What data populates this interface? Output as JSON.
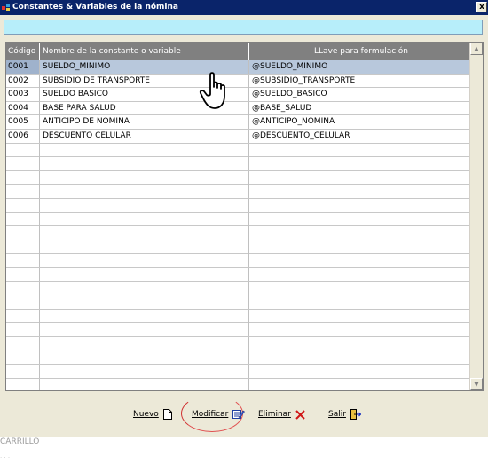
{
  "window": {
    "title": "Constantes & Variables de la nómina",
    "close_label": "x"
  },
  "search": {
    "value": "",
    "placeholder": ""
  },
  "grid": {
    "headers": [
      "Código",
      "Nombre de la constante o variable",
      "LLave para formulación"
    ],
    "rows": [
      [
        "0001",
        "SUELDO_MINIMO",
        "@SUELDO_MINIMO"
      ],
      [
        "0002",
        "SUBSIDIO DE TRANSPORTE",
        "@SUBSIDIO_TRANSPORTE"
      ],
      [
        "0003",
        "SUELDO BASICO",
        "@SUELDO_BASICO"
      ],
      [
        "0004",
        "BASE PARA SALUD",
        "@BASE_SALUD"
      ],
      [
        "0005",
        "ANTICIPO DE NOMINA",
        "@ANTICIPO_NOMINA"
      ],
      [
        "0006",
        "DESCUENTO CELULAR",
        "@DESCUENTO_CELULAR"
      ]
    ],
    "selected_row": 0
  },
  "buttons": {
    "nuevo": "Nuevo",
    "modificar": "Modificar",
    "eliminar": "Eliminar",
    "salir": "Salir"
  },
  "status": {
    "user": "CARRILLO"
  },
  "colors": {
    "titlebar": "#0a246a",
    "search_bg": "#b7eefa",
    "header_bg": "#808080",
    "selected_row": "#b8c8dc",
    "annotation_circle": "#e05050"
  }
}
